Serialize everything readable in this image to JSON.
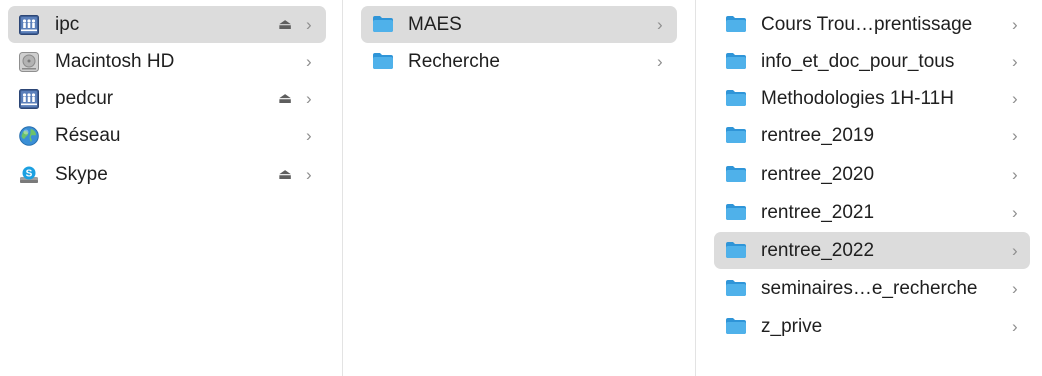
{
  "columns": {
    "sidebar": {
      "items": [
        {
          "label": "ipc",
          "icon": "network-volume-icon",
          "eject": true,
          "selected": true
        },
        {
          "label": "Macintosh HD",
          "icon": "hard-drive-icon",
          "eject": false,
          "selected": false
        },
        {
          "label": "pedcur",
          "icon": "network-volume-icon",
          "eject": true,
          "selected": false
        },
        {
          "label": "Réseau",
          "icon": "network-globe-icon",
          "eject": false,
          "selected": false
        },
        {
          "label": "Skype",
          "icon": "skype-disk-icon",
          "eject": true,
          "selected": false
        }
      ]
    },
    "ipc": {
      "items": [
        {
          "label": "MAES",
          "icon": "folder-icon",
          "selected": true
        },
        {
          "label": "Recherche",
          "icon": "folder-icon",
          "selected": false
        }
      ]
    },
    "maes": {
      "items": [
        {
          "label": "Cours Trou…prentissage",
          "icon": "folder-icon",
          "selected": false
        },
        {
          "label": "info_et_doc_pour_tous",
          "icon": "folder-icon",
          "selected": false
        },
        {
          "label": "Methodologies 1H-11H",
          "icon": "folder-icon",
          "selected": false
        },
        {
          "label": "rentree_2019",
          "icon": "folder-icon",
          "selected": false
        },
        {
          "label": "rentree_2020",
          "icon": "folder-icon",
          "selected": false
        },
        {
          "label": "rentree_2021",
          "icon": "folder-icon",
          "selected": false
        },
        {
          "label": "rentree_2022",
          "icon": "folder-icon",
          "selected": true
        },
        {
          "label": "seminaires…e_recherche",
          "icon": "folder-icon",
          "selected": false
        },
        {
          "label": "z_prive",
          "icon": "folder-icon",
          "selected": false
        }
      ]
    }
  },
  "glyphs": {
    "chevron": "›",
    "eject": "⏏"
  },
  "colors": {
    "selection": "#dcdcdc",
    "folder": "#4fb1ea",
    "folder_tab": "#2f95d8"
  }
}
